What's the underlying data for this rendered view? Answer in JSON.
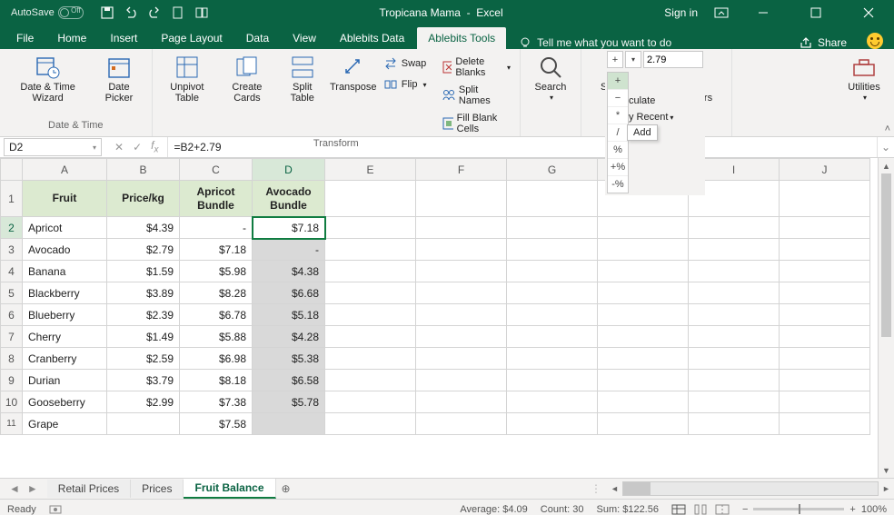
{
  "title": {
    "doc": "Tropicana Mama",
    "app": "Excel",
    "autosave": "AutoSave",
    "signin": "Sign in"
  },
  "tabs": {
    "file": "File",
    "home": "Home",
    "insert": "Insert",
    "pagelayout": "Page Layout",
    "data": "Data",
    "view": "View",
    "abdata": "Ablebits Data",
    "abtools": "Ablebits Tools",
    "tell": "Tell me what you want to do",
    "share": "Share"
  },
  "ribbon": {
    "datetime": {
      "wizard": "Date & Time Wizard",
      "picker": "Date Picker",
      "label": "Date & Time"
    },
    "transform": {
      "unpivot": "Unpivot Table",
      "cards": "Create Cards",
      "split": "Split Table",
      "transpose": "Transpose",
      "swap": "Swap",
      "flip": "Flip",
      "delblanks": "Delete Blanks",
      "splitnames": "Split Names",
      "fillblank": "Fill Blank Cells",
      "label": "Transform"
    },
    "search": "Search",
    "calc": {
      "sumcolor": "Sum by Color",
      "countchars": "Count Characters",
      "label": "Calculate",
      "culate": "culate",
      "recent": "y Recent",
      "add_tip": "Add"
    },
    "utilities": "Utilities",
    "calc_value": "2.79",
    "ops": {
      "plus": "+",
      "minus": "−",
      "mul": "*",
      "div": "/",
      "pct": "%",
      "ppct": "+%",
      "mpct": "-%"
    }
  },
  "fx": {
    "cell": "D2",
    "formula": "=B2+2.79"
  },
  "cols": [
    "",
    "A",
    "B",
    "C",
    "D",
    "E",
    "F",
    "G",
    "H",
    "I",
    "J"
  ],
  "headers": {
    "fruit": "Fruit",
    "price": "Price/kg",
    "apr": "Apricot Bundle",
    "avo": "Avocado Bundle"
  },
  "rows": [
    {
      "n": "2",
      "fruit": "Apricot",
      "price": "$4.39",
      "apr": "-",
      "avo": "$7.18"
    },
    {
      "n": "3",
      "fruit": "Avocado",
      "price": "$2.79",
      "apr": "$7.18",
      "avo": "-"
    },
    {
      "n": "4",
      "fruit": "Banana",
      "price": "$1.59",
      "apr": "$5.98",
      "avo": "$4.38"
    },
    {
      "n": "5",
      "fruit": "Blackberry",
      "price": "$3.89",
      "apr": "$8.28",
      "avo": "$6.68"
    },
    {
      "n": "6",
      "fruit": "Blueberry",
      "price": "$2.39",
      "apr": "$6.78",
      "avo": "$5.18"
    },
    {
      "n": "7",
      "fruit": "Cherry",
      "price": "$1.49",
      "apr": "$5.88",
      "avo": "$4.28"
    },
    {
      "n": "8",
      "fruit": "Cranberry",
      "price": "$2.59",
      "apr": "$6.98",
      "avo": "$5.38"
    },
    {
      "n": "9",
      "fruit": "Durian",
      "price": "$3.79",
      "apr": "$8.18",
      "avo": "$6.58"
    },
    {
      "n": "10",
      "fruit": "Gooseberry",
      "price": "$2.99",
      "apr": "$7.38",
      "avo": "$5.78"
    },
    {
      "n": "11",
      "fruit": "Grape",
      "price": "",
      "apr": "$7.58",
      "avo": ""
    }
  ],
  "sheets": {
    "s1": "Retail Prices",
    "s2": "Prices",
    "s3": "Fruit Balance"
  },
  "status": {
    "ready": "Ready",
    "avg": "Average: $4.09",
    "count": "Count: 30",
    "sum": "Sum: $122.56",
    "zoom": "100%"
  }
}
